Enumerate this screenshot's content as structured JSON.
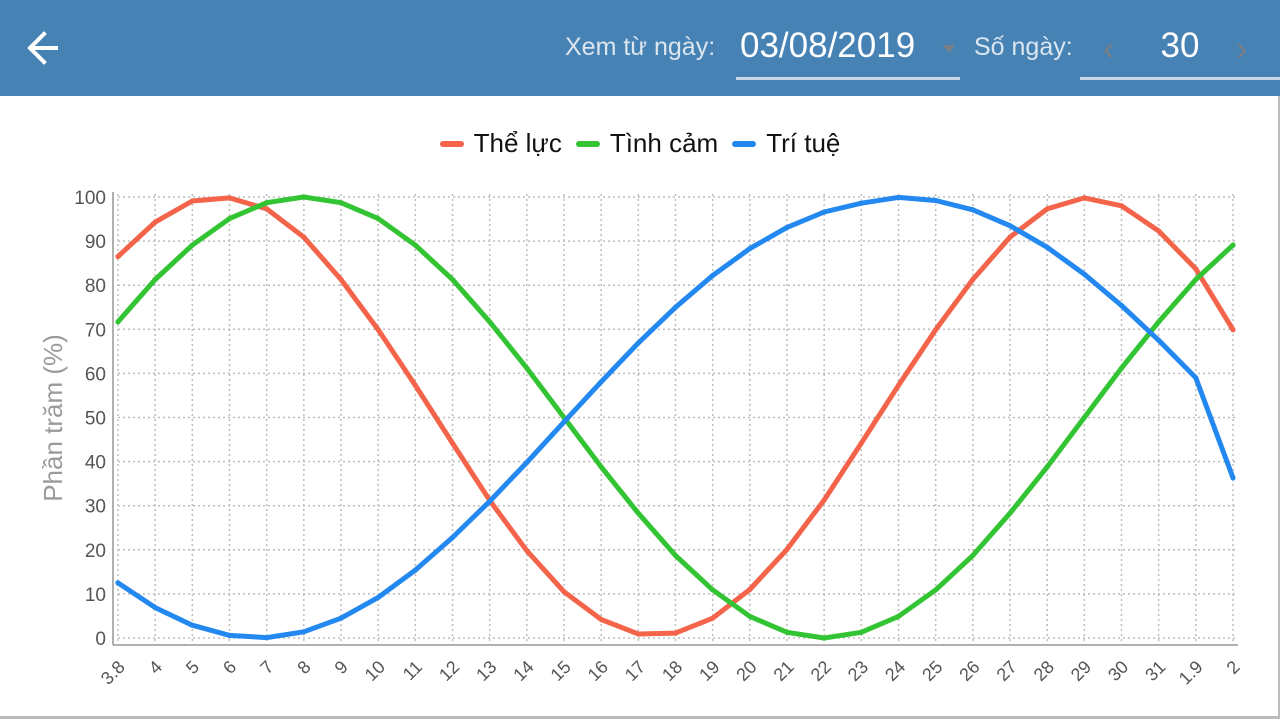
{
  "header": {
    "back_icon": "arrow-left-icon",
    "from_label": "Xem từ ngày:",
    "from_date": "03/08/2019",
    "days_label": "Số ngày:",
    "days_value": "30",
    "prev_icon": "chevron-left-icon",
    "next_icon": "chevron-right-icon",
    "bg_color": "#4682b4"
  },
  "chart_data": {
    "type": "line",
    "title": "",
    "xlabel": "",
    "ylabel": "Phần trăm (%)",
    "ylim": [
      0,
      100
    ],
    "yticks": [
      0,
      10,
      20,
      30,
      40,
      50,
      60,
      70,
      80,
      90,
      100
    ],
    "grid": true,
    "legend_position": "top-center",
    "categories": [
      "3.8",
      "4",
      "5",
      "6",
      "7",
      "8",
      "9",
      "10",
      "11",
      "12",
      "13",
      "14",
      "15",
      "16",
      "17",
      "18",
      "19",
      "20",
      "21",
      "22",
      "23",
      "24",
      "25",
      "26",
      "27",
      "28",
      "29",
      "30",
      "31",
      "1.9",
      "2"
    ],
    "series": [
      {
        "name": "Thể lực",
        "color": "#f4644a",
        "values": [
          86.5,
          94.3,
          99.1,
          99.8,
          97.3,
          90.9,
          81.3,
          69.9,
          57.3,
          44.2,
          31.2,
          19.8,
          10.5,
          4.2,
          0.9,
          1.1,
          4.5,
          11.0,
          20.1,
          31.3,
          44.2,
          57.3,
          69.9,
          81.3,
          90.9,
          97.3,
          99.8,
          98.0,
          92.3,
          83.7,
          69.9
        ]
      },
      {
        "name": "Tình cảm",
        "color": "#33c433",
        "values": [
          71.7,
          81.3,
          89.1,
          95.1,
          98.7,
          100.0,
          98.7,
          95.1,
          89.1,
          81.3,
          71.7,
          61.2,
          50.0,
          38.8,
          28.3,
          18.7,
          10.9,
          4.9,
          1.3,
          0.0,
          1.3,
          4.9,
          10.9,
          18.7,
          28.3,
          38.8,
          50.0,
          61.2,
          71.7,
          81.3,
          89.1
        ]
      },
      {
        "name": "Trí tuệ",
        "color": "#2389f0",
        "values": [
          12.5,
          6.9,
          2.9,
          0.6,
          0.1,
          1.4,
          4.5,
          9.2,
          15.4,
          22.8,
          31.0,
          39.8,
          49.0,
          58.1,
          66.9,
          75.0,
          82.2,
          88.3,
          93.1,
          96.6,
          98.6,
          99.9,
          99.2,
          97.1,
          93.5,
          88.6,
          82.5,
          75.4,
          67.5,
          59.0,
          36.3
        ]
      }
    ]
  }
}
